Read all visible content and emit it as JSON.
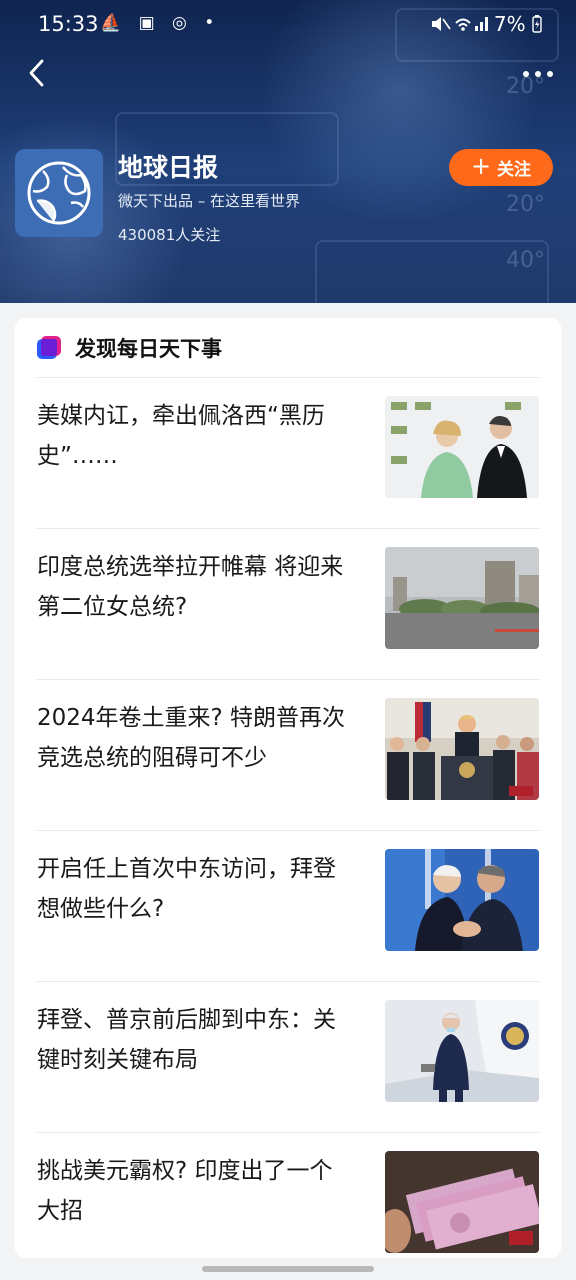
{
  "status_bar": {
    "time": "15:33",
    "icons": "⛵ ▣ ◎ •",
    "battery": "7%"
  },
  "header": {
    "name": "地球日报",
    "subtitle": "微天下出品 – 在这里看世界",
    "followers": "430081人关注",
    "follow_label": "关注",
    "follow_plus": "+",
    "deco_numbers": [
      "20°",
      "20°",
      "40°"
    ]
  },
  "section": {
    "title": "发现每日天下事"
  },
  "news": [
    {
      "title": "美媒内讧，牵出佩洛西“黑历史”……"
    },
    {
      "title": "印度总统选举拉开帷幕 将迎来第二位女总统?"
    },
    {
      "title": "2024年卷土重来? 特朗普再次竞选总统的阻碍可不少"
    },
    {
      "title": "开启任上首次中东访问，拜登想做些什么?"
    },
    {
      "title": "拜登、普京前后脚到中东：关键时刻关键布局"
    },
    {
      "title": "挑战美元霸权? 印度出了一个大招"
    }
  ],
  "colors": {
    "header_bg": "#1f3f78",
    "follow_button": "#ff6a1a",
    "logo_bg": "#3d6db5"
  }
}
